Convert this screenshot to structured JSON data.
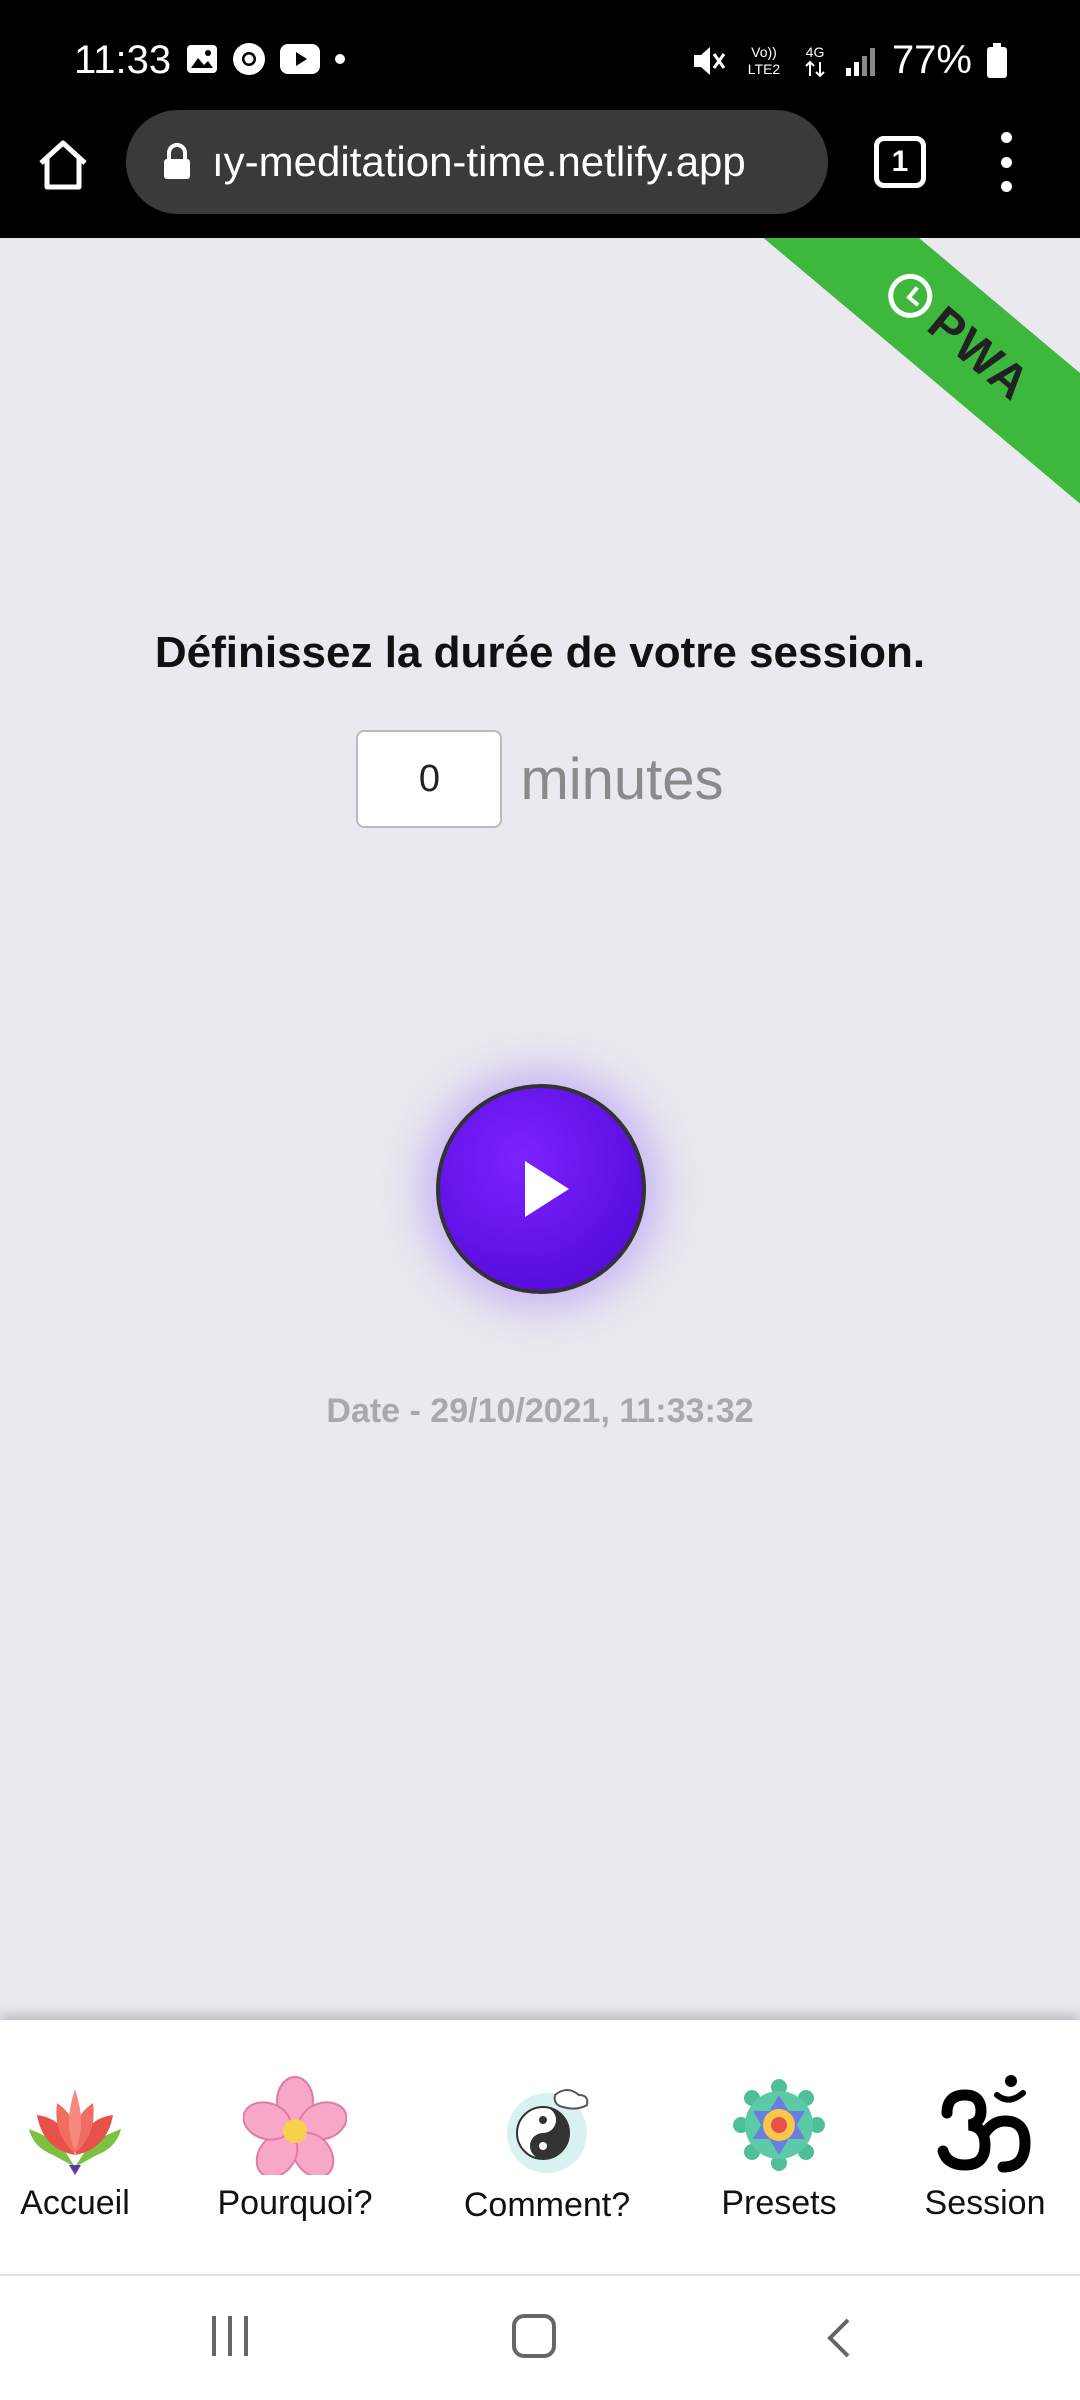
{
  "status_bar": {
    "time": "11:33",
    "battery": "77%",
    "network": "4G",
    "volte": "Vo)) LTE2"
  },
  "browser": {
    "url": "ıy-meditation-time.netlify.app",
    "tab_count": "1"
  },
  "ribbon": {
    "text": "PWA"
  },
  "session": {
    "title": "Définissez la durée de votre session.",
    "minutes_value": "0",
    "minutes_label": "minutes",
    "date": "Date - 29/10/2021, 11:33:32"
  },
  "nav": {
    "items": [
      {
        "label": "Accueil",
        "icon": "lotus-icon"
      },
      {
        "label": "Pourquoi?",
        "icon": "flower-icon"
      },
      {
        "label": "Comment?",
        "icon": "yin-yang-icon"
      },
      {
        "label": "Presets",
        "icon": "mandala-icon"
      },
      {
        "label": "Session",
        "icon": "om-icon"
      }
    ]
  },
  "colors": {
    "ribbon": "#3db83d",
    "play_button": "#5a0ee0",
    "background": "#e9e9ef"
  }
}
